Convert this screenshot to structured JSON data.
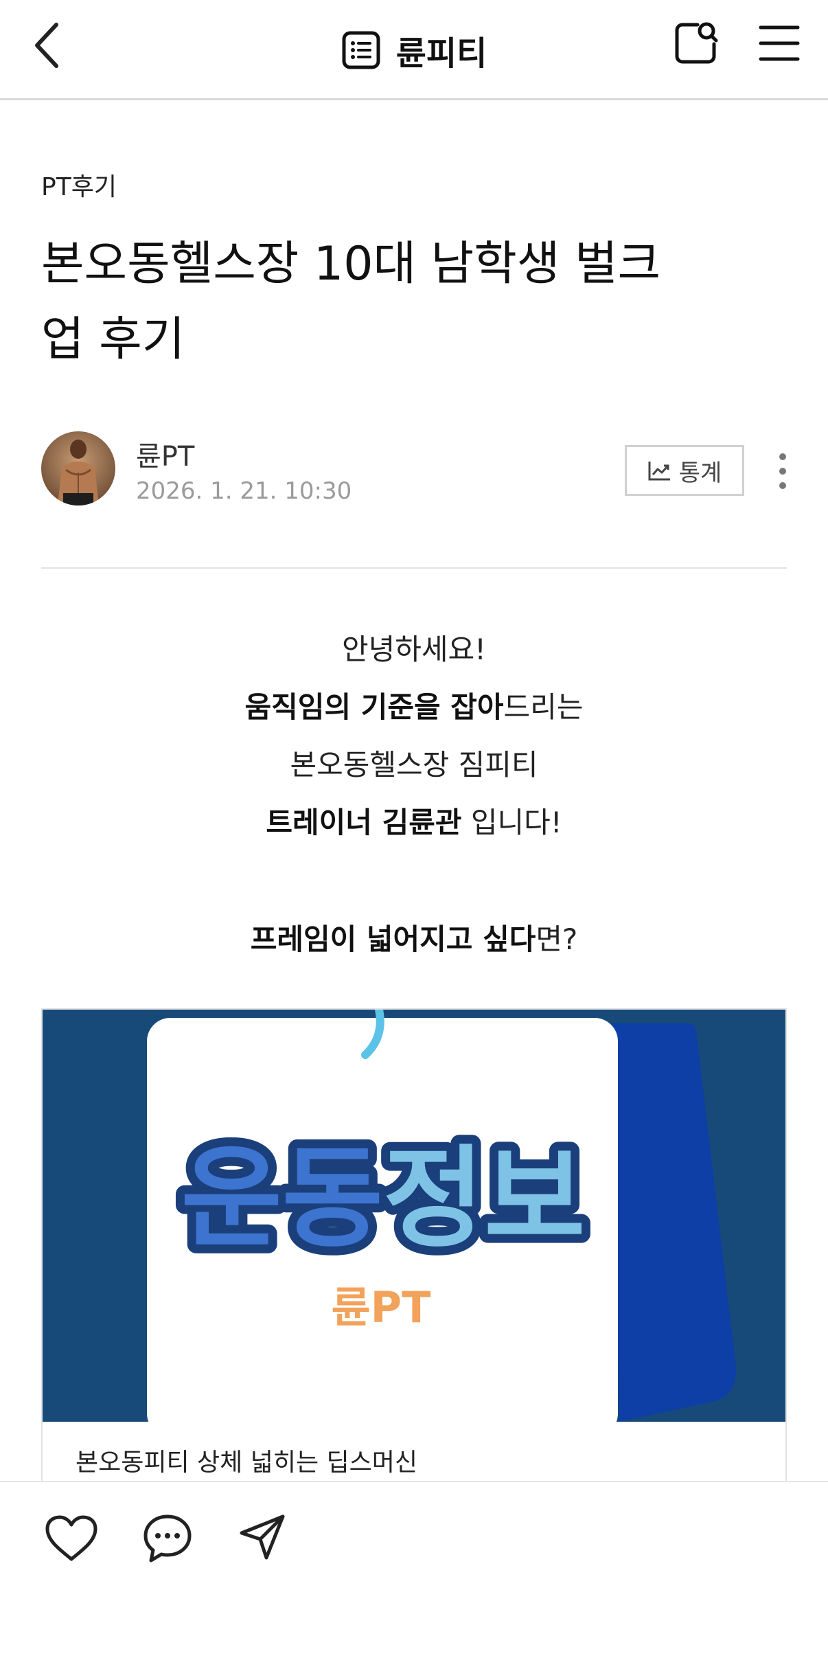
{
  "header": {
    "blog_title": "륜피티",
    "icons": {
      "back": "chevron-left-icon",
      "list": "list-icon",
      "search": "search-icon",
      "menu": "hamburger-menu-icon"
    }
  },
  "post": {
    "category": "PT후기",
    "title_line1": "본오동헬스장 10대 남학생 벌크",
    "title_line2": "업 후기",
    "author": "륜PT",
    "date": "2026. 1. 21. 10:30",
    "stats_label": "통계"
  },
  "content": {
    "line1": "안녕하세요!",
    "line2_bold": "움직임의 기준을 잡아",
    "line2_rest": "드리는",
    "line3": "본오동헬스장 짐피티",
    "line4_bold": "트레이너 김륜관",
    "line4_rest": " 입니다!",
    "line5_bold": "프레임이 넓어지고 싶다",
    "line5_rest": "면?"
  },
  "card": {
    "image_title": "운동정보",
    "image_subtitle": "륜PT",
    "caption": "본오동피티 상체 넓히는 딥스머신"
  },
  "colors": {
    "card_bg": "#174a78",
    "card_accent": "#0d3fa6",
    "title_dark": "#1b3f7a",
    "title_blue": "#3d74cf",
    "title_light": "#7ec3e6",
    "subtitle_orange": "#f2a25a"
  },
  "bottom": {
    "icons": {
      "like": "heart-icon",
      "comment": "comment-icon",
      "share": "send-icon"
    }
  }
}
